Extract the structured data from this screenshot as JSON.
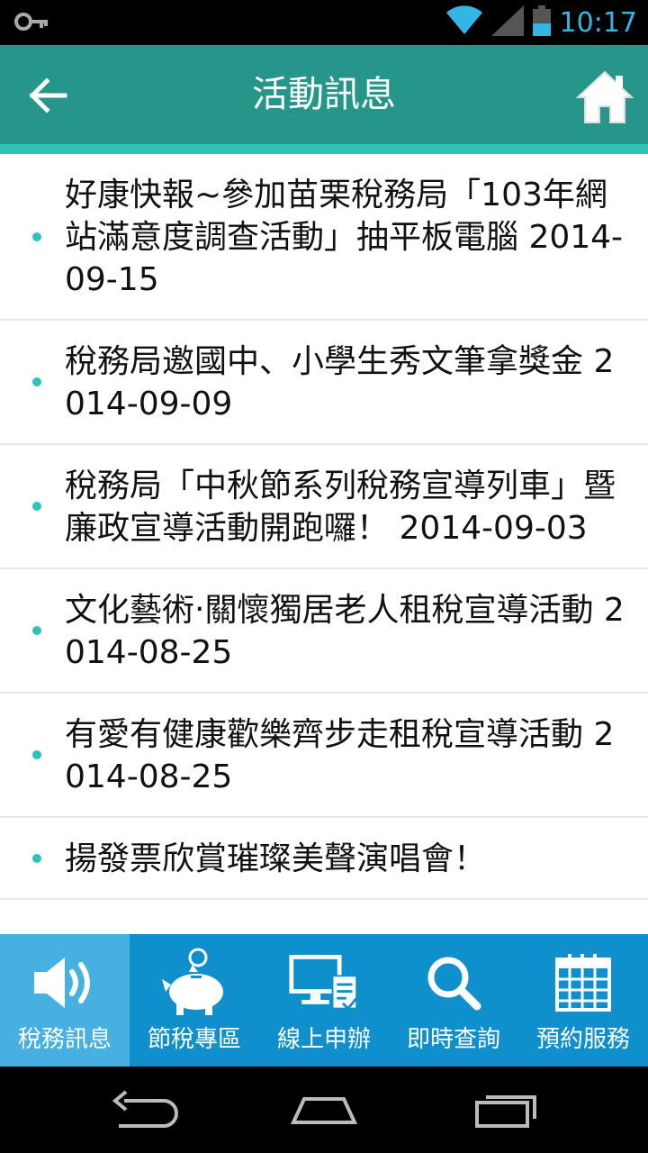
{
  "status_bar": {
    "time": "10:17",
    "time_color": "#33b5e5",
    "icons": [
      "key-icon",
      "wifi-icon",
      "signal-icon",
      "battery-icon"
    ]
  },
  "header": {
    "title": "活動訊息",
    "background": "#26968a",
    "accent": "#2cc4b4",
    "back_icon": "arrow-left-icon",
    "home_icon": "home-icon"
  },
  "news": [
    {
      "text": "好康快報~參加苗栗稅務局「103年網站滿意度調查活動」抽平板電腦 2014-09-15"
    },
    {
      "text": "稅務局邀國中、小學生秀文筆拿獎金 2014-09-09"
    },
    {
      "text": "稅務局「中秋節系列稅務宣導列車」暨廉政宣導活動開跑囉！ 2014-09-03"
    },
    {
      "text": "文化藝術‧關懷獨居老人租稅宣導活動 2014-08-25"
    },
    {
      "text": "有愛有健康歡樂齊步走租稅宣導活動 2014-08-25"
    },
    {
      "text": "揚發票欣賞璀璨美聲演唱會！"
    }
  ],
  "bottom_nav": {
    "background": "#0f8fcb",
    "active_background": "#46b1e0",
    "items": [
      {
        "label": "稅務訊息",
        "icon": "speaker-icon",
        "active": true
      },
      {
        "label": "節稅專區",
        "icon": "piggy-bank-icon",
        "active": false
      },
      {
        "label": "線上申辦",
        "icon": "computer-icon",
        "active": false
      },
      {
        "label": "即時查詢",
        "icon": "search-icon",
        "active": false
      },
      {
        "label": "預約服務",
        "icon": "calendar-icon",
        "active": false
      }
    ]
  },
  "system_nav": {
    "icons": [
      "back-nav-icon",
      "home-nav-icon",
      "recents-icon"
    ]
  }
}
